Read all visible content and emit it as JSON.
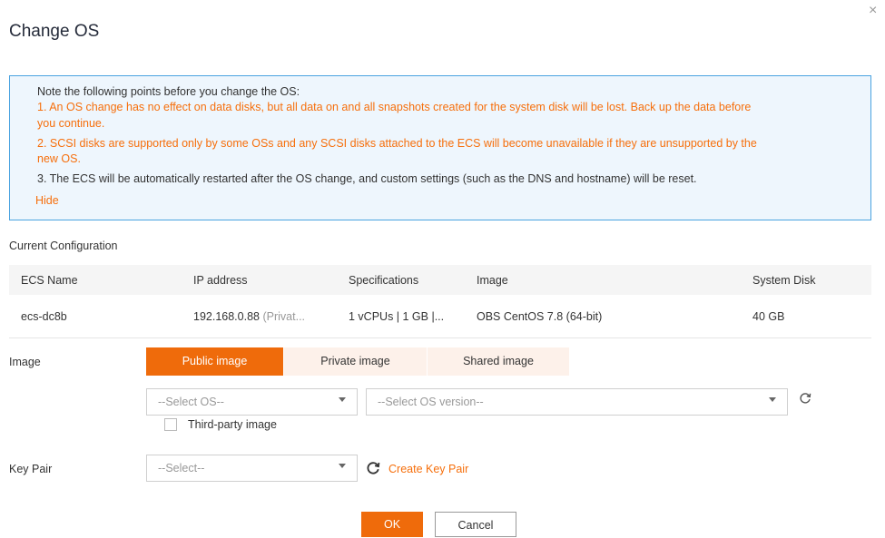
{
  "dialog": {
    "title": "Change OS",
    "close_icon": "×"
  },
  "notice": {
    "intro": "Note the following points before you change the OS:",
    "point1_line1": "1. An OS change has no effect on data disks, but all data on and all snapshots created for the system disk will be lost. Back up the data before",
    "point1_line2": "you continue.",
    "point2_line1": "2. SCSI disks are supported only by some OSs and any SCSI disks attached to the ECS will become unavailable if they are unsupported by the",
    "point2_line2": "new OS.",
    "point3": "3. The ECS will be automatically restarted after the OS change, and custom settings (such as the DNS and hostname) will be reset.",
    "hide_link": "Hide"
  },
  "current_config": {
    "label": "Current Configuration",
    "columns": [
      "ECS Name",
      "IP address",
      "Specifications",
      "Image",
      "System Disk"
    ],
    "row": {
      "ecs_name": "ecs-dc8b",
      "ip": "192.168.0.88",
      "ip_suffix": "(Privat...",
      "specs": "1 vCPUs | 1 GB |...",
      "image": "OBS CentOS 7.8 (64-bit)",
      "system_disk": "40 GB"
    }
  },
  "image": {
    "label": "Image",
    "tabs": [
      "Public image",
      "Private image",
      "Shared image"
    ],
    "active_tab": "Public image",
    "os_select_placeholder": "--Select OS--",
    "os_version_placeholder": "--Select OS version--",
    "third_party_label": "Third-party image",
    "third_party_checked": false
  },
  "key_pair": {
    "label": "Key Pair",
    "select_placeholder": "--Select--",
    "create_link": "Create Key Pair"
  },
  "footer": {
    "ok_label": "OK",
    "cancel_label": "Cancel"
  },
  "colors": {
    "accent": "#ef6b0b",
    "warning_text": "#f66f0c",
    "notice_bg": "#eef6fd",
    "notice_border": "#4aa3e0"
  }
}
